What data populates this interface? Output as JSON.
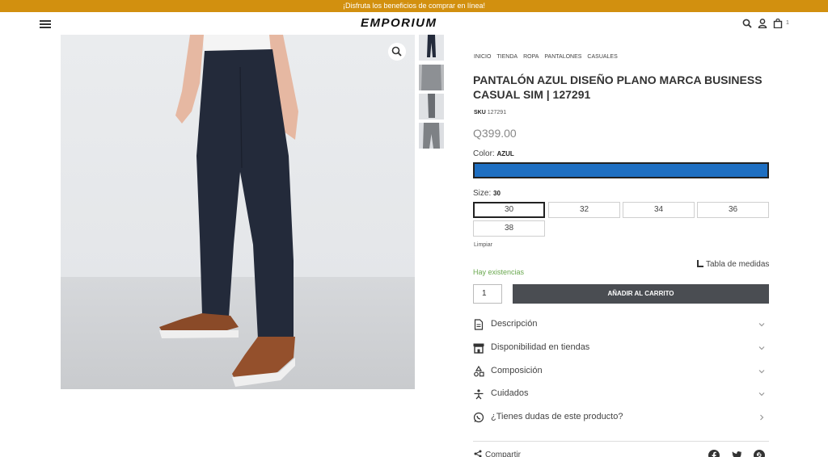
{
  "promo": {
    "text": "¡Disfruta los beneficios de comprar en línea!"
  },
  "header": {
    "logo": "EMPORIUM",
    "cart_count": "1",
    "icons": [
      "menu-icon",
      "search-icon",
      "user-icon",
      "cart-icon"
    ]
  },
  "gallery": {
    "main_image": "navy-pants-photo",
    "thumbnails": [
      "thumb-front",
      "thumb-back",
      "thumb-side",
      "thumb-detail"
    ]
  },
  "product": {
    "breadcrumb": [
      "INICIO",
      "TIENDA",
      "ROPA",
      "PANTALONES",
      "CASUALES"
    ],
    "title": "PANTALÓN AZUL DISEÑO PLANO MARCA BUSINESS CASUAL SIM | 127291",
    "sku_label": "SKU",
    "sku_value": "127291",
    "price": "Q399.00",
    "color_label": "Color:",
    "color_value": "AZUL",
    "color_hex": "#1e6fc2",
    "size_label": "Size:",
    "size_value": "30",
    "sizes": [
      "30",
      "32",
      "34",
      "36",
      "38"
    ],
    "clear_label": "Limpiar",
    "stock_text": "Hay existencias",
    "size_chart_label": "Tabla de medidas",
    "quantity": "1",
    "add_to_cart_label": "AÑADIR AL CARRITO"
  },
  "accordion": [
    {
      "label": "Descripción",
      "icon": "document-icon"
    },
    {
      "label": "Disponibilidad en tiendas",
      "icon": "store-icon"
    },
    {
      "label": "Composición",
      "icon": "shapes-icon"
    },
    {
      "label": "Cuidados",
      "icon": "care-icon"
    },
    {
      "label": "¿Tienes dudas de este producto?",
      "icon": "whatsapp-icon"
    }
  ],
  "share": {
    "label": "Compartir",
    "icons": [
      "facebook-icon",
      "twitter-icon",
      "pinterest-icon"
    ]
  },
  "colors": {
    "promo_bar": "#d2900f",
    "button": "#4a4d52",
    "stock": "#6aa84f"
  }
}
